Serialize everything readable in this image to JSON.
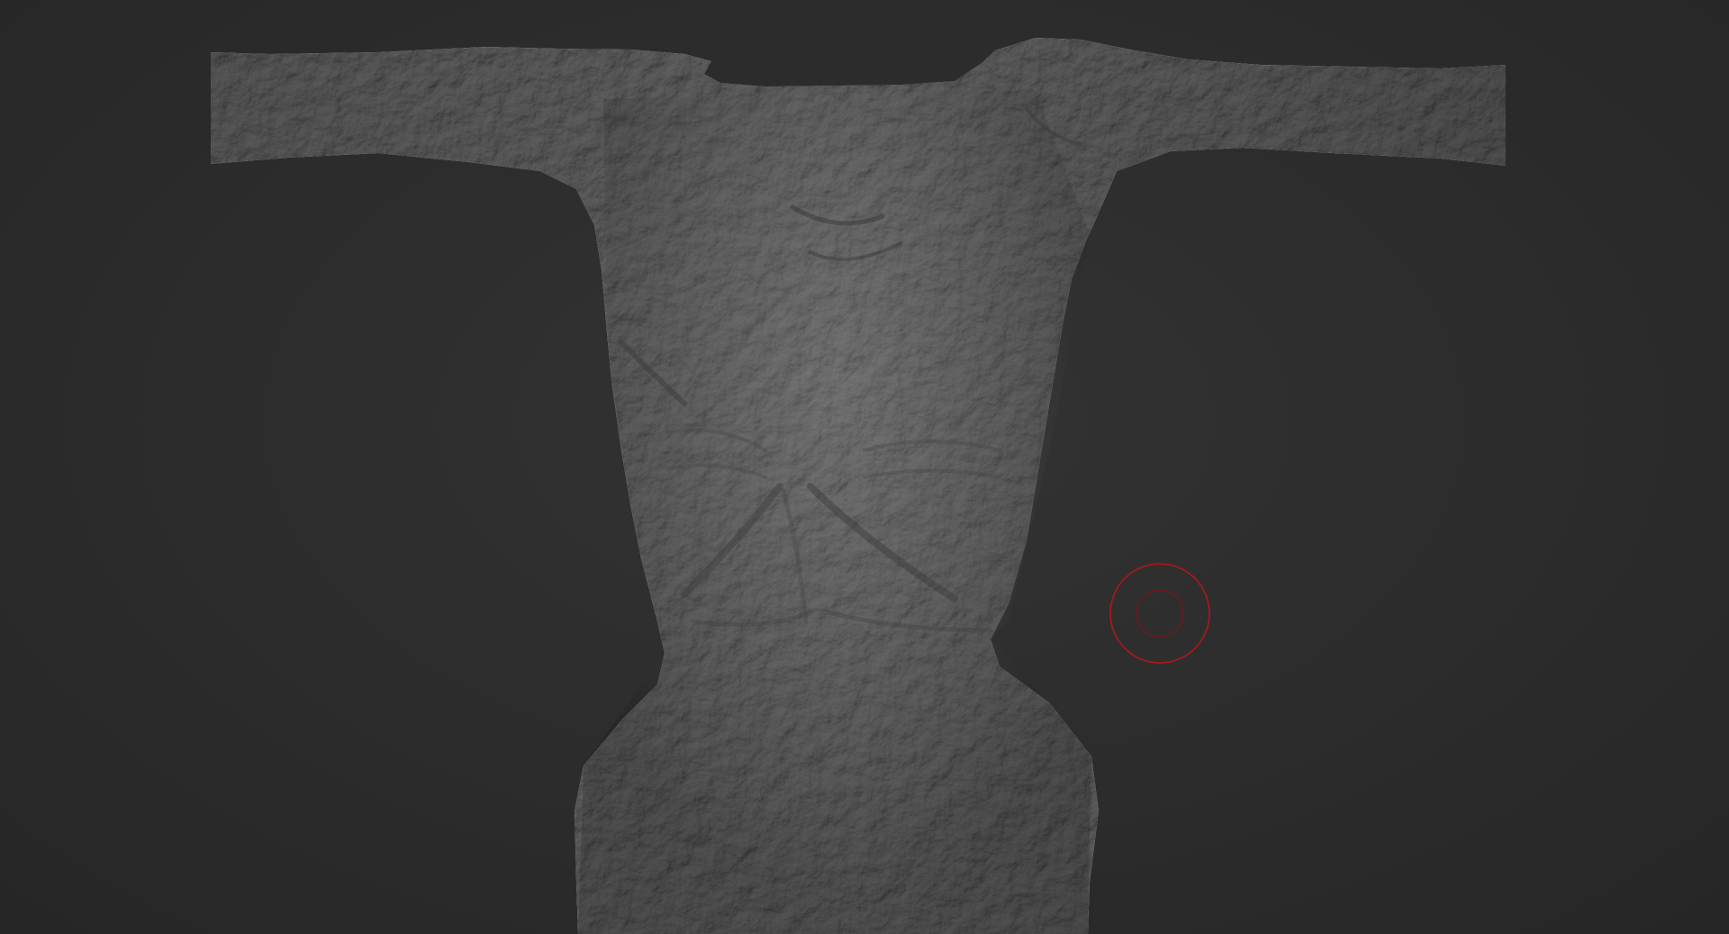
{
  "viewport": {
    "background_color": "#2b2b2b",
    "model": {
      "type": "sculpted torso mesh (T-pose, head and legs cut off)",
      "material_color": "#7a7a7a",
      "shadow_color": "#3e3e3e",
      "highlight_color": "#9b9b9b"
    },
    "brush": {
      "outer_ring_color": "#b0161c",
      "inner_ring_color": "#7e1418"
    }
  }
}
